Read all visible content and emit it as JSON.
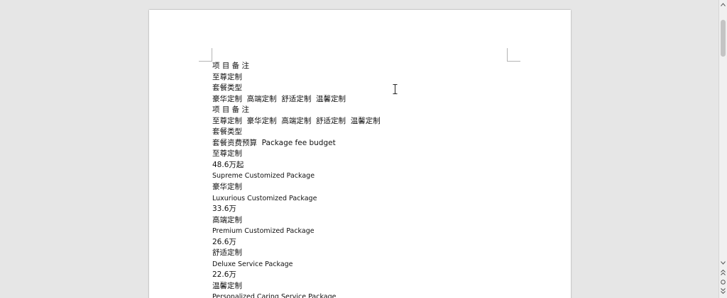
{
  "document": {
    "lines": [
      {
        "text": "项 目 备 注"
      },
      {
        "text": "至尊定制"
      },
      {
        "text": "套餐类型"
      },
      {
        "text": "豪华定制  高端定制  舒适定制  温馨定制"
      },
      {
        "text": "项 目 备 注"
      },
      {
        "text": "至尊定制  豪华定制  高端定制  舒适定制  温馨定制"
      },
      {
        "text": "套餐类型"
      },
      {
        "text": "套餐资费预算  Package fee budget"
      },
      {
        "text": "至尊定制"
      },
      {
        "text": "48.6万起"
      },
      {
        "text": "Supreme Customized Package"
      },
      {
        "text": "豪华定制"
      },
      {
        "text": "Luxurious Customized Package"
      },
      {
        "text": "33.6万"
      },
      {
        "text": "高端定制"
      },
      {
        "text": "Premium Customized Package"
      },
      {
        "text": "26.6万"
      },
      {
        "text": "舒适定制"
      },
      {
        "text": "Deluxe Service Package"
      },
      {
        "text": "22.6万"
      },
      {
        "text": "温馨定制"
      },
      {
        "text": "Personalized Caring Service Package"
      }
    ]
  },
  "icons": {
    "text_cursor": "i-beam-cursor-icon",
    "scroll_up": "chevron-up-icon",
    "scroll_down": "chevron-down-icon",
    "prev_page": "double-chevron-up-icon",
    "next_page": "double-chevron-down-icon",
    "browse_object": "circle-icon"
  },
  "colors": {
    "background": "#e6e6e6",
    "page": "#ffffff",
    "text": "#111111",
    "scroll_thumb": "#c4c4c4"
  }
}
